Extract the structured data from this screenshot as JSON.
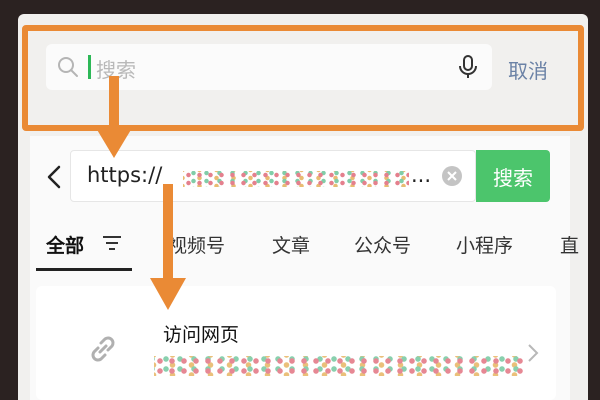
{
  "search": {
    "placeholder": "搜索",
    "cancel_label": "取消"
  },
  "url_bar": {
    "value_prefix": "https://",
    "ellipsis": "...",
    "search_button": "搜索"
  },
  "tabs": [
    {
      "label": "全部",
      "active": true
    },
    {
      "label": "视频号",
      "active": false
    },
    {
      "label": "文章",
      "active": false
    },
    {
      "label": "公众号",
      "active": false
    },
    {
      "label": "小程序",
      "active": false
    },
    {
      "label": "直",
      "active": false
    }
  ],
  "result": {
    "title": "访问网页"
  },
  "colors": {
    "accent_green": "#4cc56c",
    "highlight_orange": "#ea8a35",
    "link_blue": "#6b82a6"
  },
  "icons": [
    "search-icon",
    "microphone-icon",
    "back-arrow-icon",
    "clear-icon",
    "filter-icon",
    "link-icon",
    "chevron-right-icon"
  ]
}
